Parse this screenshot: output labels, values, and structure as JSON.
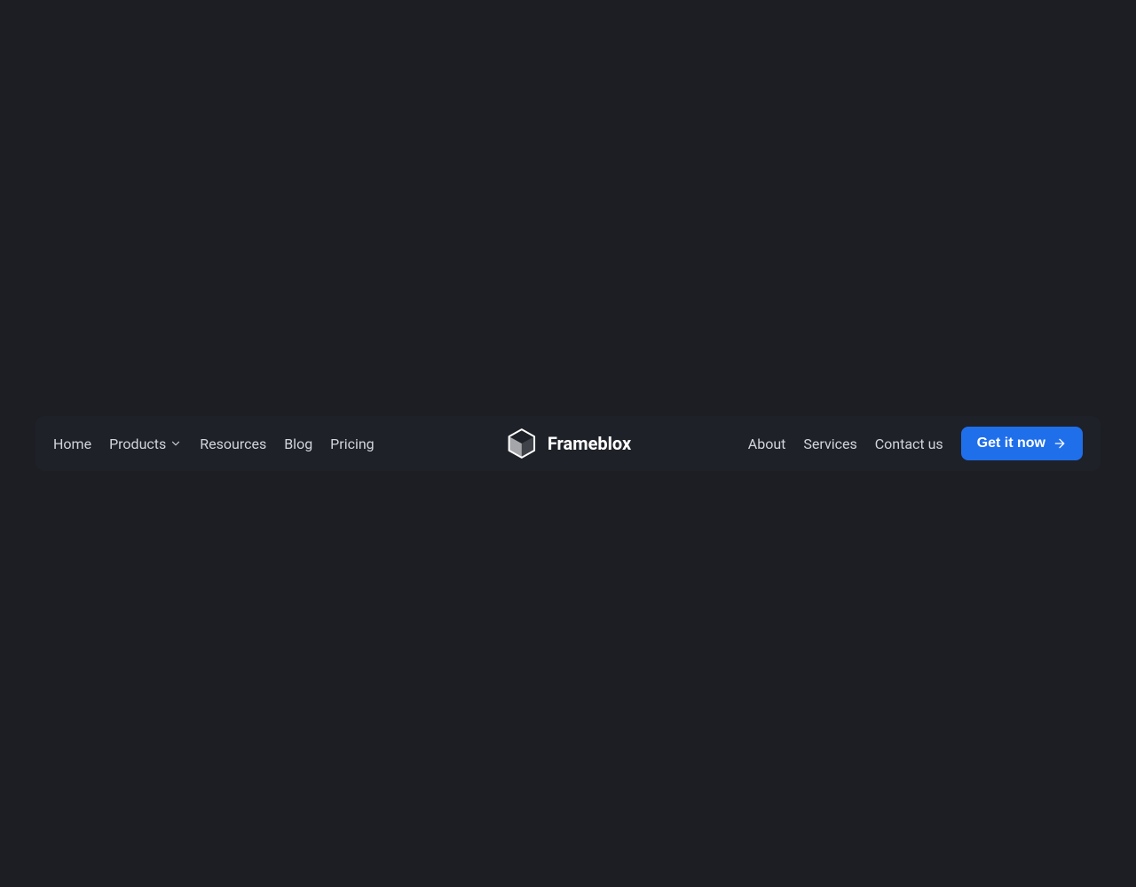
{
  "brand": {
    "name": "Frameblox"
  },
  "nav": {
    "left": {
      "home": "Home",
      "products": "Products",
      "resources": "Resources",
      "blog": "Blog",
      "pricing": "Pricing"
    },
    "right": {
      "about": "About",
      "services": "Services",
      "contact": "Contact us"
    },
    "cta": "Get it now"
  }
}
